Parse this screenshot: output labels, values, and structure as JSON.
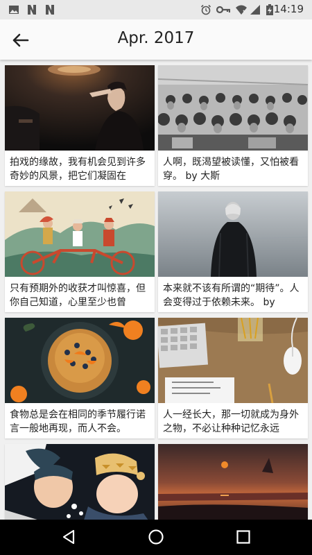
{
  "status_bar": {
    "time": "14:19",
    "left_icons": [
      "image-icon",
      "n-app-icon",
      "n-app-icon"
    ],
    "right_icons": [
      "alarm-icon",
      "key-icon",
      "wifi-icon",
      "signal-icon",
      "battery-charging-icon"
    ]
  },
  "header": {
    "title": "Apr. 2017",
    "back_icon": "arrow-left-icon"
  },
  "cards": [
    {
      "caption": "拍戏的缘故，我有机会见到许多奇妙的风景，把它们凝固在",
      "image": "woman-in-dark-theater-photo"
    },
    {
      "caption": "人啊，既渴望被读懂，又怕被看穿。 by 大斯",
      "image": "vintage-crowd-photo"
    },
    {
      "caption": "只有预期外的收获才叫惊喜，但你自己知道，心里至少也曾",
      "image": "tandem-bicycle-illustration"
    },
    {
      "caption": "本来就不该有所谓的“期待”。人会变得过于依赖未来。 by",
      "image": "person-facing-foggy-sea-photo"
    },
    {
      "caption": "食物总是会在相同的季节履行诺言一般地再现，而人不会。",
      "image": "pancakes-with-oranges-photo"
    },
    {
      "caption": "人一经长大，那一切就成为身外之物，不必让种种记忆永远",
      "image": "desk-keyboard-mouse-photo"
    },
    {
      "caption": "",
      "image": "couple-winter-illustration"
    },
    {
      "caption": "",
      "image": "sunset-landscape-painting"
    }
  ],
  "nav_bar": {
    "buttons": [
      "back-triangle-icon",
      "home-circle-icon",
      "recents-square-icon"
    ]
  },
  "colors": {
    "background": "#f0f0f0",
    "app_bar": "#fafafa",
    "status_bar": "#e9e9e9",
    "card": "#ffffff",
    "text": "#222222",
    "nav_bar": "#000000"
  }
}
